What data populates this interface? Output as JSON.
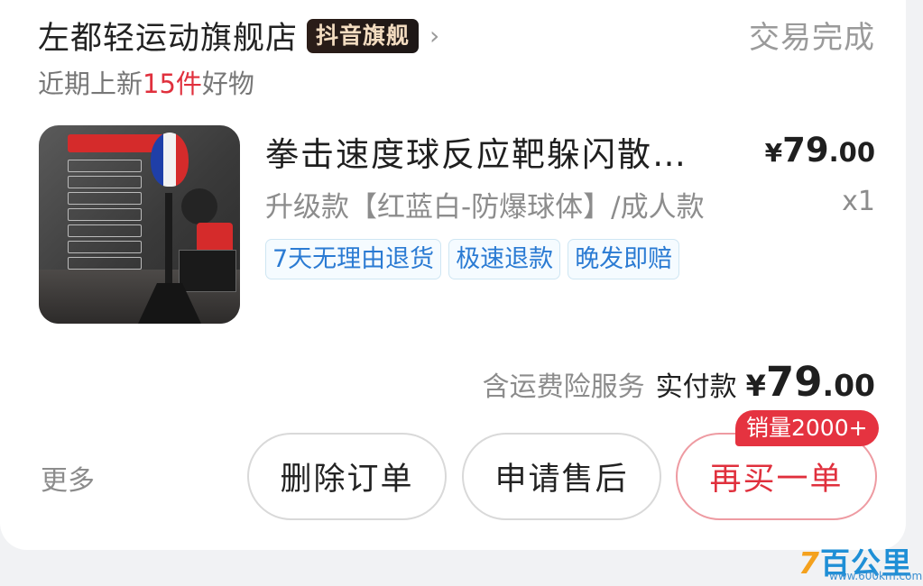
{
  "shop": {
    "name": "左都轻运动旗舰店",
    "badge": "抖音旗舰",
    "chevron": "›",
    "status": "交易完成",
    "new_items_prefix": "近期上新",
    "new_items_count": "15件",
    "new_items_suffix": "好物"
  },
  "product": {
    "title": "拳击速度球反应靶躲闪散…",
    "price_symbol": "¥",
    "price_int": "79",
    "price_dec": ".00",
    "sku": "升级款【红蓝白-防爆球体】/成人款",
    "quantity": "x1",
    "tags": [
      "7天无理由退货",
      "极速退款",
      "晚发即赔"
    ],
    "thumbnail_icon": "product-thumbnail"
  },
  "payment": {
    "insurance": "含运费险服务",
    "paid_label": "实付款",
    "symbol": "¥",
    "int": "79",
    "dec": ".00"
  },
  "actions": {
    "more": "更多",
    "delete": "删除订单",
    "after_sale": "申请售后",
    "rebuy": "再买一单",
    "sales_badge": "销量2000+"
  },
  "watermark": {
    "logo_prefix": "7",
    "logo_text": "百公里",
    "url": "www.600km.com"
  },
  "colors": {
    "accent_red": "#e0303d",
    "tag_blue": "#2b7bd3",
    "badge_gold": "#f3dcc0"
  }
}
